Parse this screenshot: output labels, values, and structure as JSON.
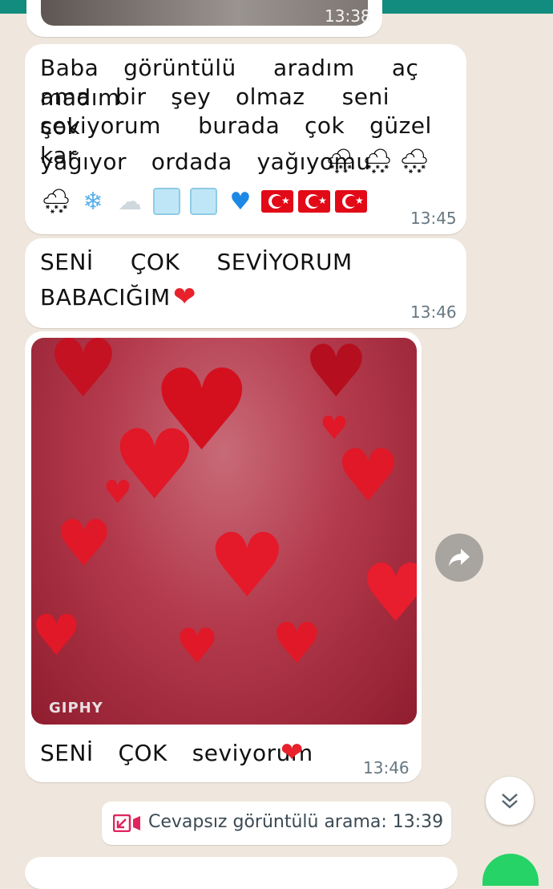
{
  "messages": [
    {
      "time": "13:38"
    },
    {
      "text_lines": [
        "Baba  görüntülü   aradım   aç  madım",
        "ama  bir  şey  olmaz   seni   çok",
        "seviyorum   burada  çok  güzel  kar",
        "yağıyor  ordada  yağıyomu"
      ],
      "emojis_line_end": [
        "cloud-snow-icon",
        "cloud-snow-icon",
        "snow-cloud-icon"
      ],
      "emojis_row": [
        "snow-cloud-icon",
        "snowflake-icon",
        "cloud-icon",
        "ice-cube-icon",
        "ice-cube-icon",
        "blue-heart-icon",
        "turkey-flag-icon",
        "turkey-flag-icon",
        "turkey-flag-icon"
      ],
      "time": "13:45"
    },
    {
      "text_lines": [
        "SENİ   ÇOK   SEVİYORUM",
        "BABACIĞIM"
      ],
      "emoji": "red-heart-icon",
      "time": "13:46"
    },
    {
      "gif_label": "GIPHY",
      "caption": "SENİ  ÇOK  seviyorum",
      "emoji": "red-heart-icon",
      "time": "13:46"
    }
  ],
  "system_notice": {
    "text": "Cevapsız görüntülü arama: 13:39",
    "icon": "missed-video-call-icon",
    "icon_color": "#e0245e"
  },
  "colors": {
    "header": "#128c7e",
    "background": "#efe7dd",
    "bubble": "#ffffff",
    "timestamp": "#667781"
  }
}
